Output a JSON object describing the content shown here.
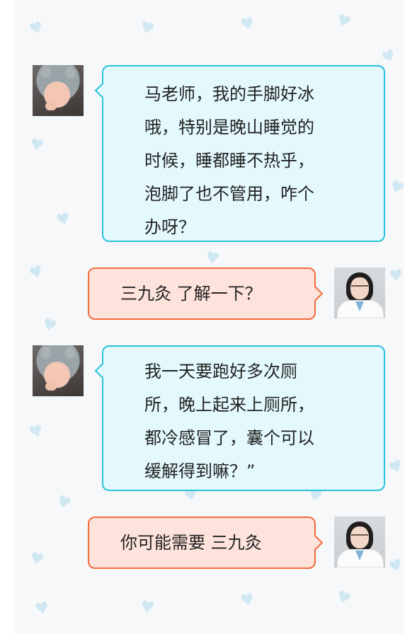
{
  "theme": {
    "user_bubble_bg": "#e3f9fd",
    "user_bubble_border": "#29c3d9",
    "doctor_bubble_bg": "#fde3db",
    "doctor_bubble_border": "#f26b3c",
    "background": "#f7f8f9",
    "heart_color": "#cfe8f3"
  },
  "decor": {
    "heart_glyph": "♥"
  },
  "messages": [
    {
      "sender": "user",
      "avatar": "user-avatar",
      "lines": [
        "马老师，我的手脚好冰",
        "哦，特别是晚山睡觉的",
        "时候，睡都睡不热乎，",
        "泡脚了也不管用，咋个",
        "办呀？"
      ]
    },
    {
      "sender": "doctor",
      "avatar": "doctor-avatar",
      "lines": [
        "三九灸 了解一下？"
      ]
    },
    {
      "sender": "user",
      "avatar": "user-avatar",
      "lines": [
        "我一天要跑好多次厕",
        "所，晚上起来上厕所，",
        "都冷感冒了，囊个可以",
        "缓解得到嘛？”"
      ]
    },
    {
      "sender": "doctor",
      "avatar": "doctor-avatar",
      "lines": [
        "你可能需要 三九灸"
      ]
    }
  ]
}
